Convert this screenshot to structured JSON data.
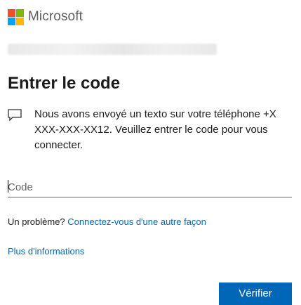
{
  "header": {
    "brand": "Microsoft",
    "logo_colors": [
      "#f25022",
      "#7fba00",
      "#00a4ef",
      "#ffb900"
    ]
  },
  "identity": {
    "obscured": true
  },
  "main": {
    "title": "Entrer le code",
    "message_icon": "chat-bubble-icon",
    "message": "Nous avons envoyé un texto sur votre téléphone +X XXX-XXX-XX12. Veuillez entrer le code pour vous connecter.",
    "code_input": {
      "placeholder": "Code",
      "value": ""
    },
    "problem_prefix": "Un problème?",
    "problem_link": "Connectez-vous d'une autre façon",
    "more_info_link": "Plus d'informations",
    "verify_button": "Vérifier"
  },
  "colors": {
    "accent": "#0067b8",
    "text": "#1b1b1b"
  }
}
